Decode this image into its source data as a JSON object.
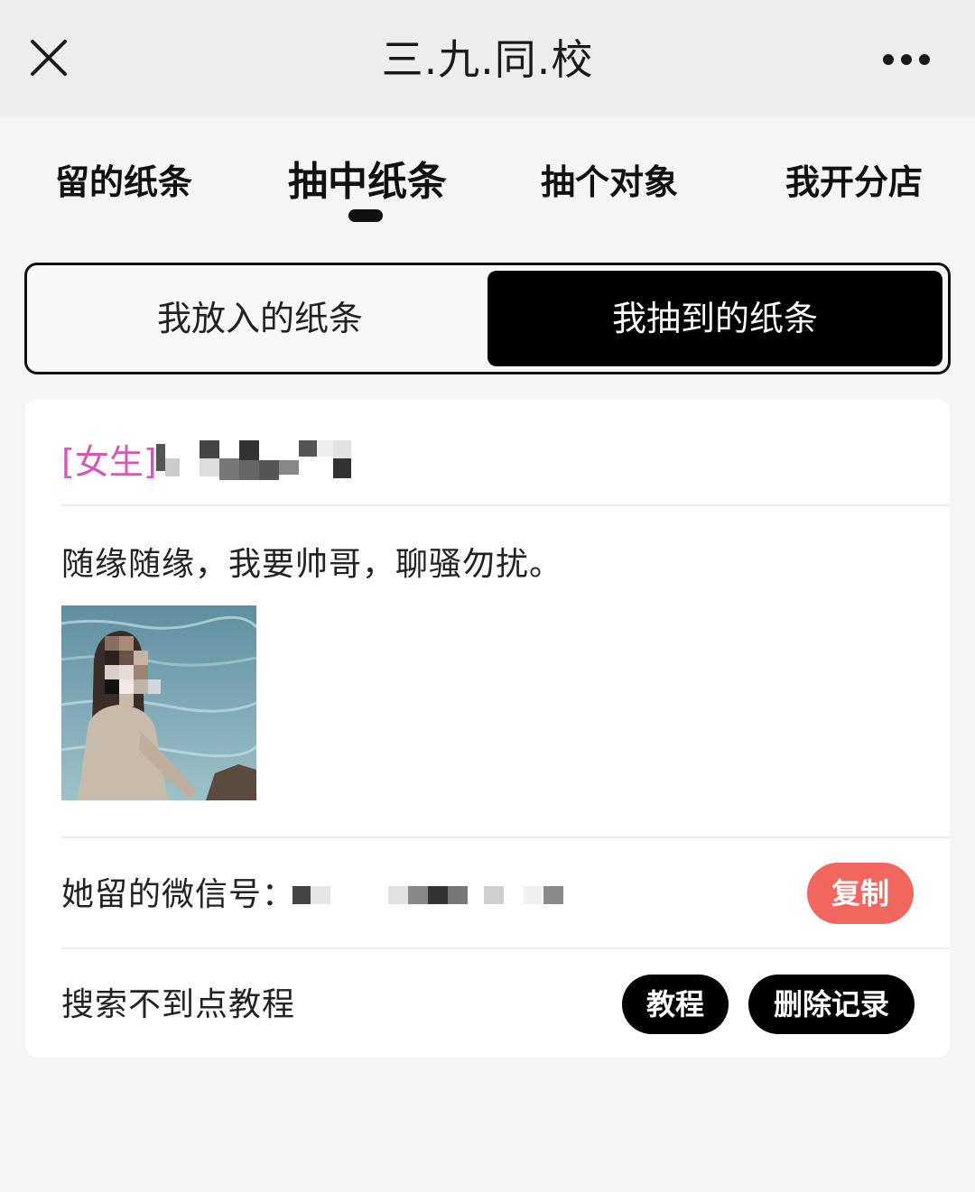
{
  "header": {
    "title": "三.九.同.校"
  },
  "tabs": [
    {
      "label": "留的纸条",
      "active": false
    },
    {
      "label": "抽中纸条",
      "active": true
    },
    {
      "label": "抽个对象",
      "active": false
    },
    {
      "label": "我开分店",
      "active": false
    }
  ],
  "segment": {
    "left_label": "我放入的纸条",
    "right_label": "我抽到的纸条",
    "selected": "我抽到的纸条"
  },
  "card": {
    "gender_tag": "[女生]",
    "message": "随缘随缘，我要帅哥，聊骚勿扰。",
    "wechat_label": "她留的微信号：",
    "copy_label": "复制",
    "search_hint": "搜索不到点教程",
    "tutorial_label": "教程",
    "delete_label": "删除记录"
  },
  "colors": {
    "accent_pink": "#d35ab4",
    "copy_red": "#f1665f",
    "topbar_bg": "#ededed",
    "page_bg": "#f5f5f5"
  },
  "icons": [
    "close-icon",
    "more-icon"
  ]
}
